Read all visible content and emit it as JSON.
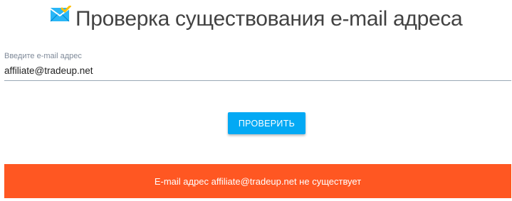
{
  "header": {
    "icon": "mail-check-icon",
    "title": "Проверка существования e-mail адреса"
  },
  "email_field": {
    "label": "Введите e-mail адрес",
    "value": "affiliate@tradeup.net"
  },
  "check_button": {
    "label": "ПРОВЕРИТЬ"
  },
  "result": {
    "message": "E-mail адрес affiliate@tradeup.net не существует"
  },
  "colors": {
    "accent": "#03a9f4",
    "error": "#ff5722",
    "title_text": "#424242",
    "label_text": "#7f8a99"
  }
}
